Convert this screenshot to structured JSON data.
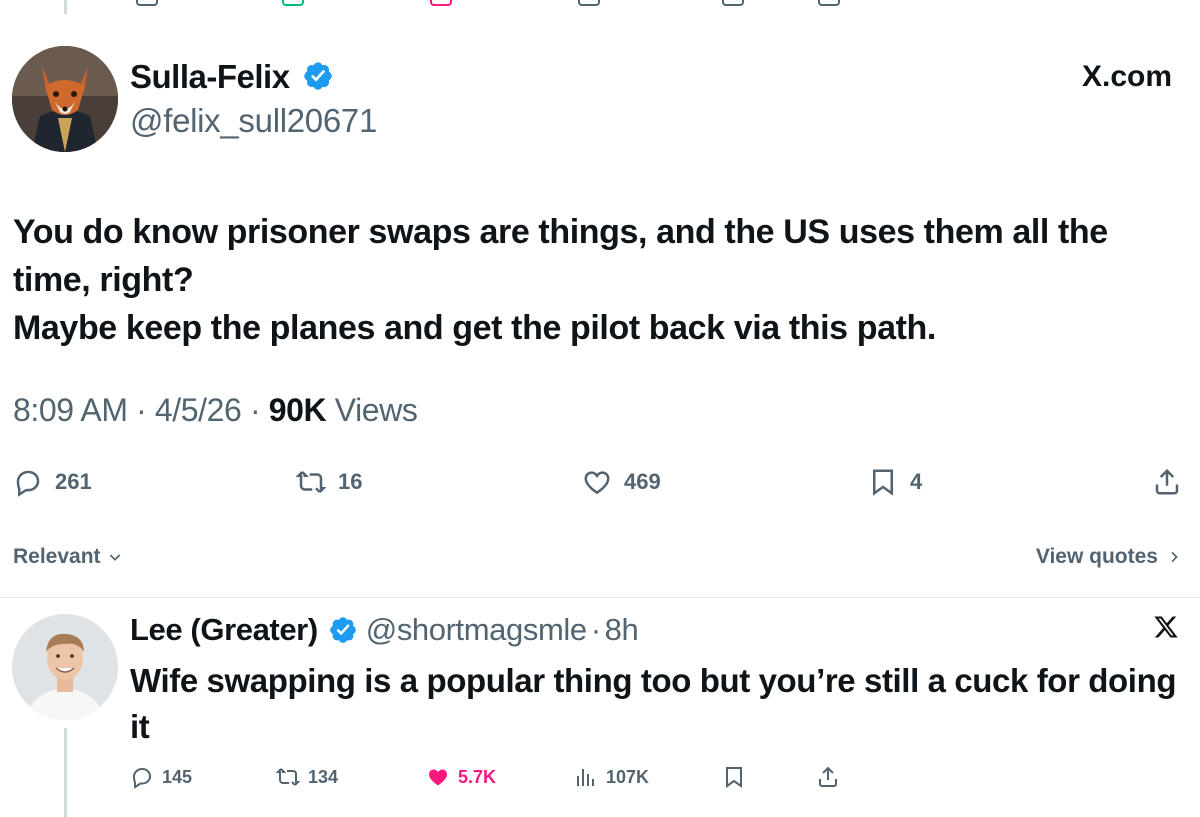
{
  "main_tweet": {
    "author_name": "Sulla-Felix",
    "author_handle": "@felix_sull20671",
    "verified": true,
    "brand_label": "X.com",
    "text_lines": [
      "You do know prisoner swaps are things, and the US uses them all the",
      "time, right?",
      "Maybe keep the planes and get the pilot back via this path."
    ],
    "time": "8:09 AM",
    "date": "4/5/26",
    "views_count": "90K",
    "views_label": "Views",
    "separator": "·",
    "actions": {
      "replies": "261",
      "reposts": "16",
      "likes": "469",
      "bookmarks": "4"
    }
  },
  "filter": {
    "sort_label": "Relevant",
    "view_quotes_label": "View quotes"
  },
  "reply": {
    "author_name": "Lee (Greater)",
    "author_handle": "@shortmagsmle",
    "separator": "·",
    "time": "8h",
    "verified": true,
    "text_lines": [
      "Wife swapping is a popular thing too but you’re still a cuck for doing",
      "it"
    ],
    "actions": {
      "replies": "145",
      "reposts": "134",
      "likes": "5.7K",
      "views": "107K"
    },
    "liked": true
  },
  "colors": {
    "text": "#0f1419",
    "secondary": "#536471",
    "verified_blue": "#1d9bf0",
    "like_pink": "#f91880",
    "divider": "#e1e8ed"
  },
  "icons": [
    "reply-icon",
    "repost-icon",
    "like-icon",
    "bookmark-icon",
    "share-icon",
    "views-icon",
    "verified-icon",
    "x-logo-icon",
    "chevron-down-icon",
    "chevron-right-icon"
  ]
}
